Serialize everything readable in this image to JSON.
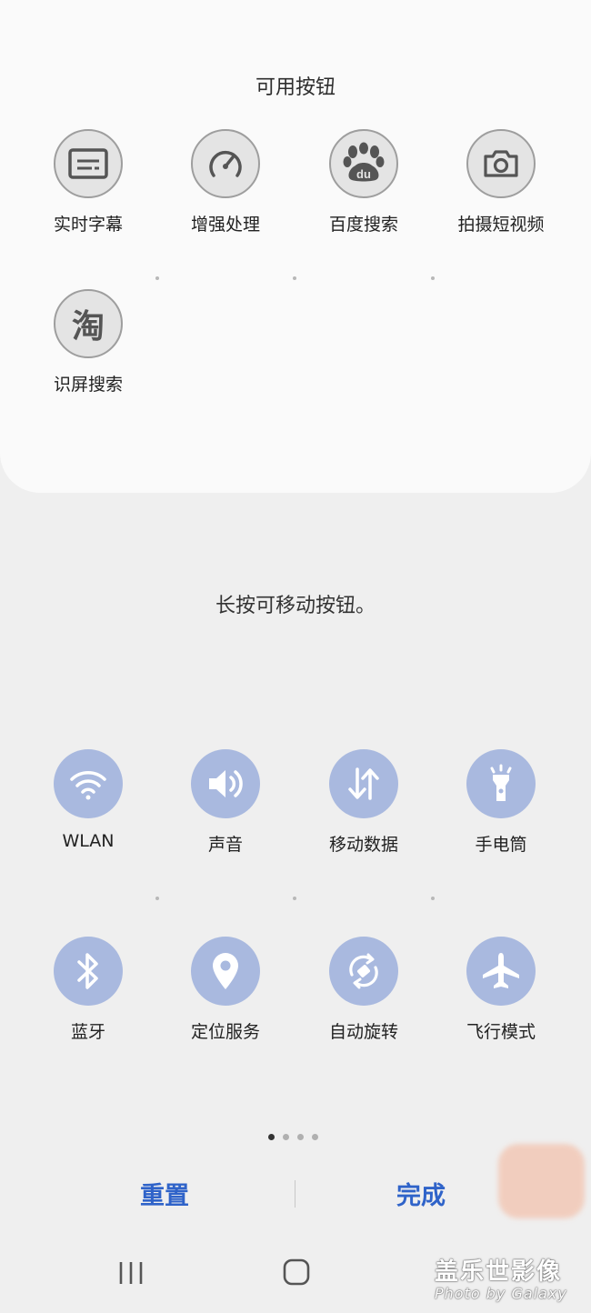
{
  "available": {
    "title": "可用按钮",
    "buttons": [
      {
        "label": "实时字幕",
        "icon": "caption-icon"
      },
      {
        "label": "增强处理",
        "icon": "gauge-icon"
      },
      {
        "label": "百度搜索",
        "icon": "baidu-paw-icon"
      },
      {
        "label": "拍摄短视频",
        "icon": "camera-icon"
      },
      {
        "label": "识屏搜索",
        "icon": "taobao-icon",
        "glyph": "淘"
      }
    ]
  },
  "hint": "长按可移动按钮。",
  "active": {
    "buttons": [
      {
        "label": "WLAN",
        "icon": "wifi-icon"
      },
      {
        "label": "声音",
        "icon": "sound-icon"
      },
      {
        "label": "移动数据",
        "icon": "mobile-data-icon"
      },
      {
        "label": "手电筒",
        "icon": "flashlight-icon"
      },
      {
        "label": "蓝牙",
        "icon": "bluetooth-icon"
      },
      {
        "label": "定位服务",
        "icon": "location-icon"
      },
      {
        "label": "自动旋转",
        "icon": "auto-rotate-icon"
      },
      {
        "label": "飞行模式",
        "icon": "airplane-icon"
      }
    ],
    "accent": "#a9b9df"
  },
  "pager": {
    "pages": 4,
    "current": 1
  },
  "actions": {
    "reset": "重置",
    "done": "完成",
    "color": "#2f63c9"
  },
  "watermark": {
    "line1": "盖乐世影像",
    "line2": "Photo by Galaxy"
  }
}
